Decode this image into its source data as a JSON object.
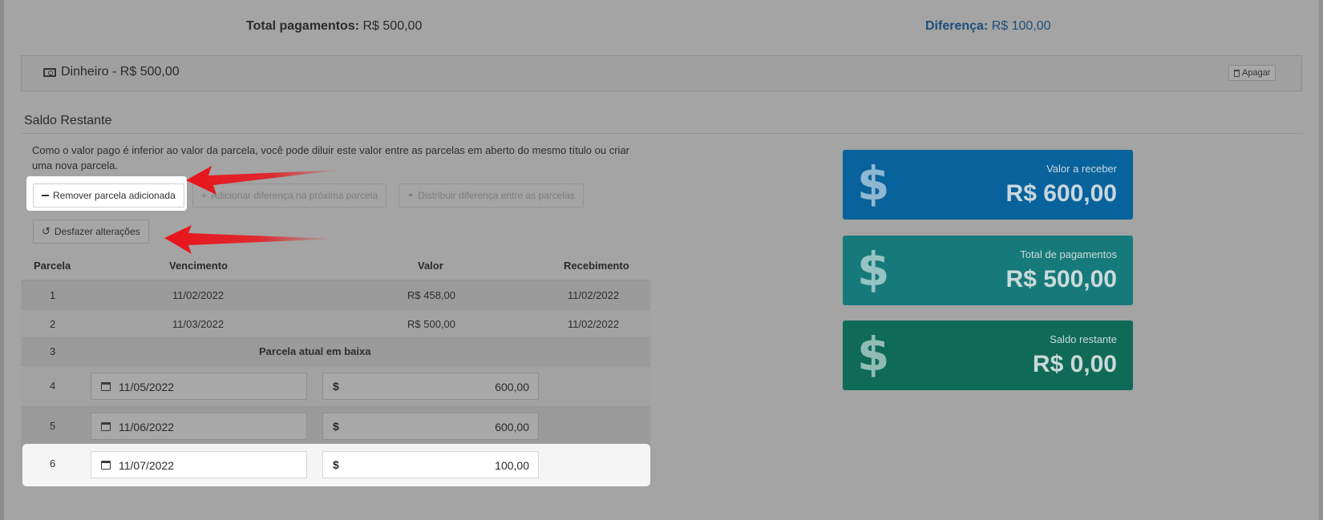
{
  "header": {
    "total_label": "Total pagamentos:",
    "total_value": "R$ 500,00",
    "diff_label": "Diferença:",
    "diff_value": "R$ 100,00"
  },
  "payment": {
    "icon": "money-icon",
    "label": "Dinheiro - R$ 500,00",
    "delete_label": "Apagar"
  },
  "saldo": {
    "title": "Saldo Restante",
    "description": "Como o valor pago é inferior ao valor da parcela, você pode diluir este valor entre as parcelas em aberto do mesmo título ou criar uma nova parcela.",
    "btn_remove": "Remover parcela adicionada",
    "btn_add_next": "Adicionar diferença na próxima parcela",
    "btn_distribute": "Distribuir diferença entre as parcelas",
    "btn_undo": "Desfazer alterações"
  },
  "table": {
    "headers": [
      "Parcela",
      "Vencimento",
      "Valor",
      "Recebimento"
    ],
    "rows": [
      {
        "parcela": "1",
        "vencimento": "11/02/2022",
        "valor": "R$ 458,00",
        "recebimento": "11/02/2022"
      },
      {
        "parcela": "2",
        "vencimento": "11/03/2022",
        "valor": "R$ 500,00",
        "recebimento": "11/02/2022"
      },
      {
        "parcela": "3",
        "note": "Parcela atual em baixa"
      },
      {
        "parcela": "4",
        "date": "11/05/2022",
        "currency": "$",
        "amount": "600,00"
      },
      {
        "parcela": "5",
        "date": "11/06/2022",
        "currency": "$",
        "amount": "600,00"
      },
      {
        "parcela": "6",
        "date": "11/07/2022",
        "currency": "$",
        "amount": "100,00"
      }
    ]
  },
  "cards": [
    {
      "icon": "dollar-icon",
      "label": "Valor a receber",
      "value": "R$ 600,00",
      "color": "#08629c"
    },
    {
      "icon": "dollar-icon",
      "label": "Total de pagamentos",
      "value": "R$ 500,00",
      "color": "#177a7a"
    },
    {
      "icon": "dollar-icon",
      "label": "Saldo restante",
      "value": "R$ 0,00",
      "color": "#0f6a58"
    }
  ],
  "colors": {
    "overlay": "#a4a4a4",
    "arrow": "#e8141a",
    "highlight": "#ffffff"
  }
}
